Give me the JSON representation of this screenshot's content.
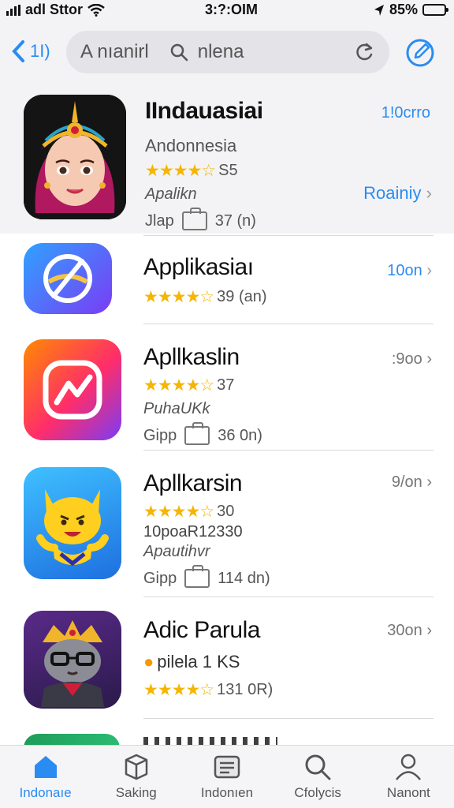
{
  "status": {
    "carrier": "adl Sttor",
    "time": "3:?:OIM",
    "battery": "85%"
  },
  "nav": {
    "back_label": "1I)",
    "search_prefix": "A nıanirl",
    "search_query": "nlena"
  },
  "featured": {
    "title": "IIndauasiai",
    "subtitle": "Andonnesia",
    "rating_text": "S5",
    "category": "Apalikn",
    "meta_left": "Jlap",
    "meta_right": "37 (n)",
    "right_label": "1!0crro",
    "action_label": "Roainiy"
  },
  "apps": [
    {
      "title": "Applikasiaı",
      "rating_text": "39 (an)",
      "right_label": "10on"
    },
    {
      "title": "Apllkaslin",
      "rating_text": "37",
      "category": "PuhaUKk",
      "meta_left": "Gipp",
      "meta_right": "36 0n)",
      "right_label": ":9oo"
    },
    {
      "title": "Apllkarsin",
      "rating_text": "30",
      "line2": "10poaR12330",
      "category": "Apautihvr",
      "meta_left": "Gipp",
      "meta_right": "114 dn)",
      "right_label": "9/on"
    },
    {
      "title": "Adic Parula",
      "line2": "pilela 1 KS",
      "rating_text": "131 0R)",
      "right_label": "30on"
    }
  ],
  "tabs": [
    {
      "label": "Indonaıe",
      "icon": "home-icon"
    },
    {
      "label": "Saking",
      "icon": "cube-icon"
    },
    {
      "label": "Indonıen",
      "icon": "stack-icon"
    },
    {
      "label": "Cfolycis",
      "icon": "search-icon"
    },
    {
      "label": "Nanont",
      "icon": "person-icon"
    }
  ],
  "colors": {
    "accent": "#2a8bf2",
    "star": "#f5b500",
    "background_top": "#f3f3f5"
  }
}
